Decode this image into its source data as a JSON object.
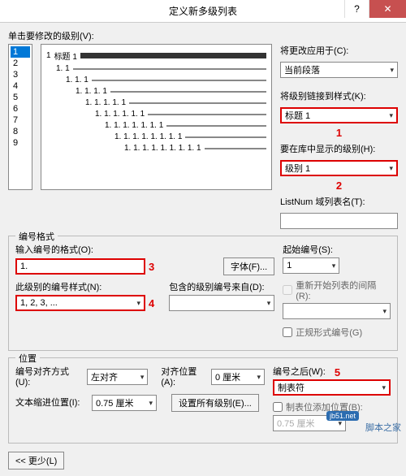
{
  "titlebar": {
    "title": "定义新多级列表"
  },
  "topLabel": "单击要修改的级别(V):",
  "levels": [
    "1",
    "2",
    "3",
    "4",
    "5",
    "6",
    "7",
    "8",
    "9"
  ],
  "selectedLevel": "1",
  "preview": [
    {
      "num": "1",
      "text": "标题 1",
      "dark": true,
      "indent": 0
    },
    {
      "num": "1. 1",
      "indent": 12
    },
    {
      "num": "1. 1. 1",
      "indent": 24
    },
    {
      "num": "1. 1. 1. 1",
      "indent": 36
    },
    {
      "num": "1. 1. 1. 1. 1",
      "indent": 48
    },
    {
      "num": "1. 1. 1. 1. 1. 1",
      "indent": 60
    },
    {
      "num": "1. 1. 1. 1. 1. 1. 1",
      "indent": 72
    },
    {
      "num": "1. 1. 1. 1. 1. 1. 1. 1",
      "indent": 84
    },
    {
      "num": "1. 1. 1. 1. 1. 1. 1. 1. 1",
      "indent": 96
    }
  ],
  "right": {
    "applyToLabel": "将更改应用于(C):",
    "applyToValue": "当前段落",
    "linkStyleLabel": "将级别链接到样式(K):",
    "linkStyleValue": "标题 1",
    "galleryLabel": "要在库中显示的级别(H):",
    "galleryValue": "级别 1",
    "listnumLabel": "ListNum 域列表名(T):"
  },
  "format": {
    "sectionTitle": "编号格式",
    "inputFmtLabel": "输入编号的格式(O):",
    "inputFmtValue": "1.",
    "fontBtn": "字体(F)...",
    "styleLabel": "此级别的编号样式(N):",
    "styleValue": "1, 2, 3, ...",
    "includeLabel": "包含的级别编号来自(D):",
    "startLabel": "起始编号(S):",
    "startValue": "1",
    "restartLabel": "重新开始列表的间隔(R):",
    "legalLabel": "正规形式编号(G)"
  },
  "position": {
    "sectionTitle": "位置",
    "alignLabel": "编号对齐方式(U):",
    "alignValue": "左对齐",
    "alignAtLabel": "对齐位置(A):",
    "alignAtValue": "0 厘米",
    "indentLabel": "文本缩进位置(I):",
    "indentValue": "0.75 厘米",
    "setAllBtn": "设置所有级别(E)...",
    "followLabel": "编号之后(W):",
    "followValue": "制表符",
    "tabStopLabel": "制表位添加位置(B):",
    "tabStopValue": "0.75 厘米"
  },
  "lessBtn": "<< 更少(L)",
  "annot": {
    "n1": "1",
    "n2": "2",
    "n3": "3",
    "n4": "4",
    "n5": "5"
  },
  "watermark": "脚本之家",
  "logo": "jb51.net"
}
